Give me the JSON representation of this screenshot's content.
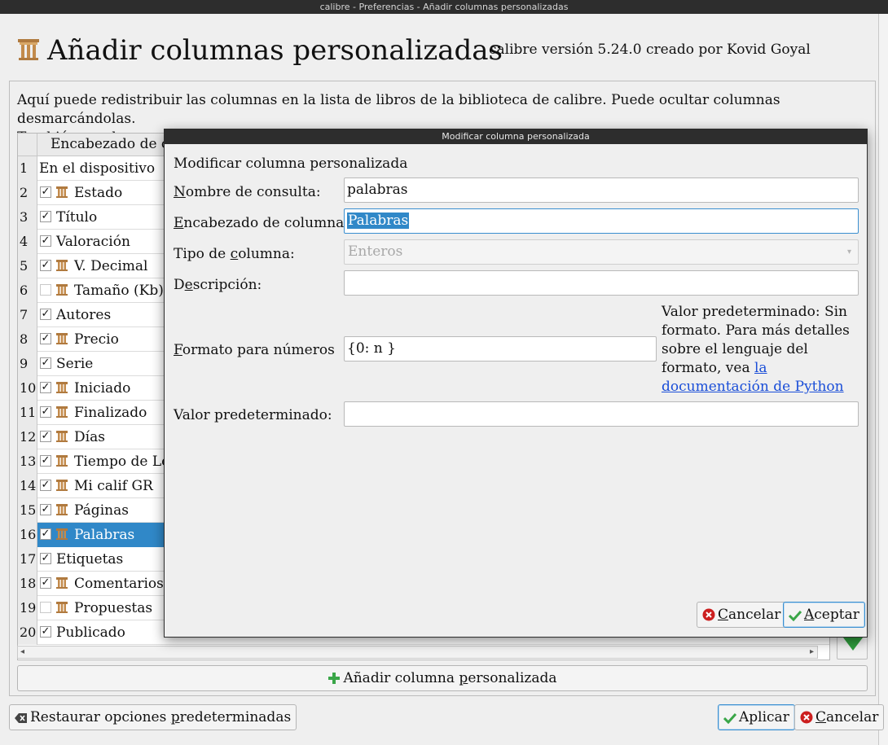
{
  "window": {
    "title": "calibre - Preferencias - Añadir columnas personalizadas"
  },
  "header": {
    "title": "Añadir columnas personalizadas",
    "version": "calibre versión 5.24.0 creado por Kovid Goyal"
  },
  "info_text": {
    "line1": "Aquí puede redistribuir las columnas en la lista de libros de la biblioteca de calibre. Puede ocultar columnas desmarcándolas.",
    "line2": "También puede crear columnas personalizadas."
  },
  "table": {
    "header_label": "Encabezado de co",
    "rows": [
      {
        "num": "1",
        "label": "En el dispositivo",
        "checkbox": "none",
        "icon": false
      },
      {
        "num": "2",
        "label": "Estado",
        "checkbox": "checked",
        "icon": true
      },
      {
        "num": "3",
        "label": "Título",
        "checkbox": "checked",
        "icon": false
      },
      {
        "num": "4",
        "label": "Valoración",
        "checkbox": "checked",
        "icon": false
      },
      {
        "num": "5",
        "label": "V. Decimal",
        "checkbox": "checked",
        "icon": true
      },
      {
        "num": "6",
        "label": "Tamaño (Kb)",
        "checkbox": "unchecked",
        "icon": true
      },
      {
        "num": "7",
        "label": "Autores",
        "checkbox": "checked",
        "icon": false
      },
      {
        "num": "8",
        "label": "Precio",
        "checkbox": "checked",
        "icon": true
      },
      {
        "num": "9",
        "label": "Serie",
        "checkbox": "checked",
        "icon": false
      },
      {
        "num": "10",
        "label": "Iniciado",
        "checkbox": "checked",
        "icon": true
      },
      {
        "num": "11",
        "label": "Finalizado",
        "checkbox": "checked",
        "icon": true
      },
      {
        "num": "12",
        "label": "Días",
        "checkbox": "checked",
        "icon": true
      },
      {
        "num": "13",
        "label": "Tiempo de Le",
        "checkbox": "checked",
        "icon": true
      },
      {
        "num": "14",
        "label": "Mi calif GR",
        "checkbox": "checked",
        "icon": true
      },
      {
        "num": "15",
        "label": "Páginas",
        "checkbox": "checked",
        "icon": true
      },
      {
        "num": "16",
        "label": "Palabras",
        "checkbox": "checked",
        "icon": true,
        "selected": true
      },
      {
        "num": "17",
        "label": "Etiquetas",
        "checkbox": "checked",
        "icon": false
      },
      {
        "num": "18",
        "label": "Comentarios",
        "checkbox": "checked",
        "icon": true
      },
      {
        "num": "19",
        "label": "Propuestas",
        "checkbox": "unchecked",
        "icon": true
      },
      {
        "num": "20",
        "label": "Publicado",
        "checkbox": "checked",
        "icon": false
      }
    ]
  },
  "buttons": {
    "add_custom_prefix": "Añadir columna ",
    "add_custom_mnemonic": "p",
    "add_custom_suffix": "ersonalizada",
    "restore_prefix": "Restaurar opciones ",
    "restore_mnemonic": "p",
    "restore_suffix": "redeterminadas",
    "apply": "Aplicar",
    "cancel_mnemonic": "C",
    "cancel_suffix": "ancelar"
  },
  "dialog": {
    "title": "Modificar columna personalizada",
    "heading": "Modificar columna personalizada",
    "lookup_label_mnemonic": "N",
    "lookup_label_rest": "ombre de consulta:",
    "lookup_value": "palabras",
    "heading_label_mnemonic": "E",
    "heading_label_rest": "ncabezado de columna:",
    "heading_value": "Palabras",
    "type_label_pre": "Tipo de ",
    "type_label_mnemonic": "c",
    "type_label_post": "olumna:",
    "type_value": "Enteros",
    "desc_label_pre": "D",
    "desc_label_mnemonic": "e",
    "desc_label_post": "scripción:",
    "desc_value": "",
    "format_label_mnemonic": "F",
    "format_label_rest": "ormato para números",
    "format_value": "{0: n }",
    "format_note": "Valor predeterminado: Sin formato. Para más detalles sobre el lenguaje del formato, vea ",
    "format_link": "la documentación de Python",
    "default_label": "Valor predeterminado:",
    "default_value": "",
    "cancel_mnemonic": "C",
    "cancel_suffix": "ancelar",
    "ok_mnemonic": "A",
    "ok_suffix": "ceptar"
  },
  "colors": {
    "selection": "#3088c8",
    "link": "#1a4ed8",
    "titlebar": "#2d2d2d",
    "check_green": "#3aa648",
    "cancel_red": "#cc1f1f"
  },
  "icons": {
    "column": "column-icon",
    "header": "pillar-icon",
    "add": "plus-icon",
    "restore": "clear-left-icon",
    "apply": "check-icon",
    "cancel": "cancel-icon",
    "move_down": "arrow-down-icon"
  }
}
